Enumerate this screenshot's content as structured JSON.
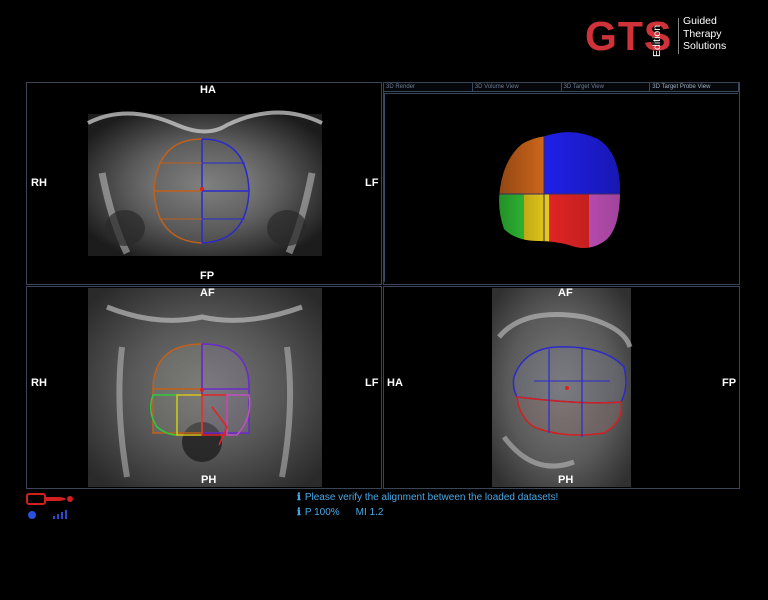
{
  "logo": {
    "brand": "GTS",
    "edition": "Edition",
    "line1": "Guided",
    "line2": "Therapy",
    "line3": "Solutions"
  },
  "views": {
    "top_left": {
      "top": "HA",
      "bottom": "FP",
      "left": "RH",
      "right": "LF"
    },
    "bottom_left": {
      "top": "AF",
      "bottom": "PH",
      "left": "RH",
      "right": "LF"
    },
    "bottom_right": {
      "top": "AF",
      "bottom": "PH",
      "left": "HA",
      "right": "FP"
    }
  },
  "render_tabs": [
    "3D Render",
    "3D Volume View",
    "3D Target View",
    "3D Target Probe View"
  ],
  "status": {
    "message": "Please verify the alignment between the loaded datasets!",
    "power": "P 100%",
    "mi": "MI 1.2"
  },
  "colors": {
    "brand": "#d0323a",
    "status_text": "#48a8e6",
    "probe": "#d02020"
  }
}
